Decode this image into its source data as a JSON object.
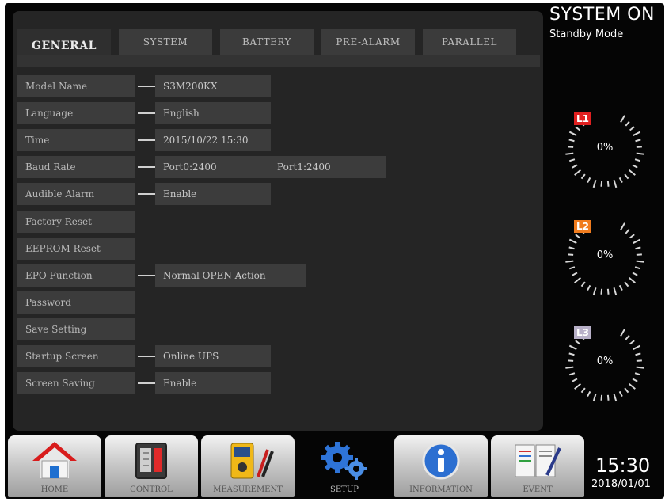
{
  "tabs": [
    "GENERAL",
    "SYSTEM",
    "BATTERY",
    "PRE-ALARM",
    "PARALLEL"
  ],
  "settings": [
    {
      "label": "Model Name",
      "values": [
        "S3M200KX"
      ]
    },
    {
      "label": "Language",
      "values": [
        "English"
      ]
    },
    {
      "label": "Time",
      "values": [
        "2015/10/22 15:30"
      ]
    },
    {
      "label": "Baud Rate",
      "values": [
        "Port0:2400",
        "Port1:2400"
      ]
    },
    {
      "label": "Audible Alarm",
      "values": [
        "Enable"
      ]
    },
    {
      "label": "Factory Reset",
      "values": []
    },
    {
      "label": "EEPROM Reset",
      "values": []
    },
    {
      "label": "EPO Function",
      "values": [
        "Normal OPEN Action"
      ]
    },
    {
      "label": "Password",
      "values": []
    },
    {
      "label": "Save Setting",
      "values": []
    },
    {
      "label": "Startup Screen",
      "values": [
        "Online UPS"
      ]
    },
    {
      "label": "Screen Saving",
      "values": [
        "Enable"
      ]
    }
  ],
  "status": {
    "title": "SYSTEM ON",
    "mode": "Standby Mode"
  },
  "gauges": [
    {
      "label": "L1",
      "value": "0%",
      "color": "#e02020"
    },
    {
      "label": "L2",
      "value": "0%",
      "color": "#f07c1e"
    },
    {
      "label": "L3",
      "value": "0%",
      "color": "#b8b0c8"
    }
  ],
  "nav": [
    {
      "label": "HOME",
      "icon": "home-icon"
    },
    {
      "label": "CONTROL",
      "icon": "control-icon"
    },
    {
      "label": "MEASUREMENT",
      "icon": "measurement-icon"
    },
    {
      "label": "SETUP",
      "icon": "gear-icon"
    },
    {
      "label": "INFORMATION",
      "icon": "info-icon"
    },
    {
      "label": "EVENT",
      "icon": "event-icon"
    }
  ],
  "clock": {
    "time": "15:30",
    "date": "2018/01/01"
  }
}
